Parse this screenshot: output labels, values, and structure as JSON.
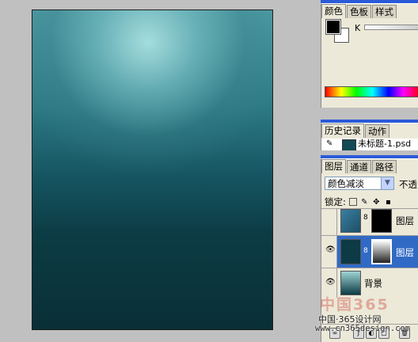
{
  "color_panel": {
    "tabs": [
      "颜色",
      "色板",
      "样式"
    ],
    "channel_label": "K"
  },
  "history_panel": {
    "tabs": [
      "历史记录",
      "动作"
    ],
    "snapshot_label": "未标题-1.psd"
  },
  "layers_panel": {
    "tabs": [
      "图层",
      "通道",
      "路径"
    ],
    "blend_mode": "颜色减淡",
    "opacity_label": "不透",
    "lock_label": "锁定:",
    "layers": [
      {
        "name": "图层",
        "visible": false,
        "selected": false
      },
      {
        "name": "图层",
        "visible": true,
        "selected": true
      },
      {
        "name": "背景",
        "visible": true,
        "selected": false
      }
    ]
  },
  "watermark": {
    "line1": "中国·365设计网",
    "line2": "www.cn365design.com",
    "logo": "中国365"
  },
  "colors": {
    "panel_bg": "#ece9d8",
    "selection": "#316ac5",
    "canvas_dark": "#0a2f36",
    "canvas_light": "#a8dcdc"
  }
}
